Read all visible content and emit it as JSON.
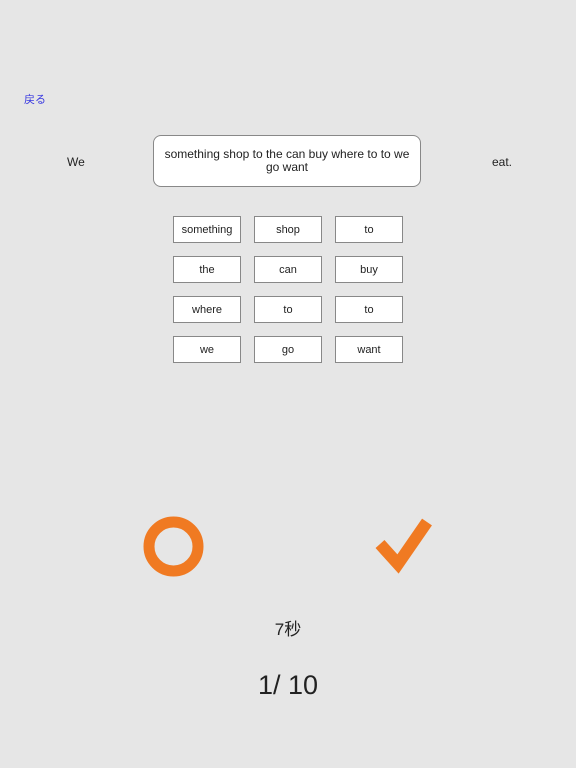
{
  "nav": {
    "back_label": "戻る"
  },
  "sentence": {
    "prefix": "We",
    "suffix": "eat.",
    "answer": "something shop to the can buy where to to we go want"
  },
  "word_choices": [
    "something",
    "shop",
    "to",
    "the",
    "can",
    "buy",
    "where",
    "to",
    "to",
    "we",
    "go",
    "want"
  ],
  "actions": {
    "circle_icon": "circle-icon",
    "check_icon": "check-icon",
    "accent_color": "#f07a22"
  },
  "status": {
    "timer": "7秒",
    "progress": "1/ 10"
  }
}
